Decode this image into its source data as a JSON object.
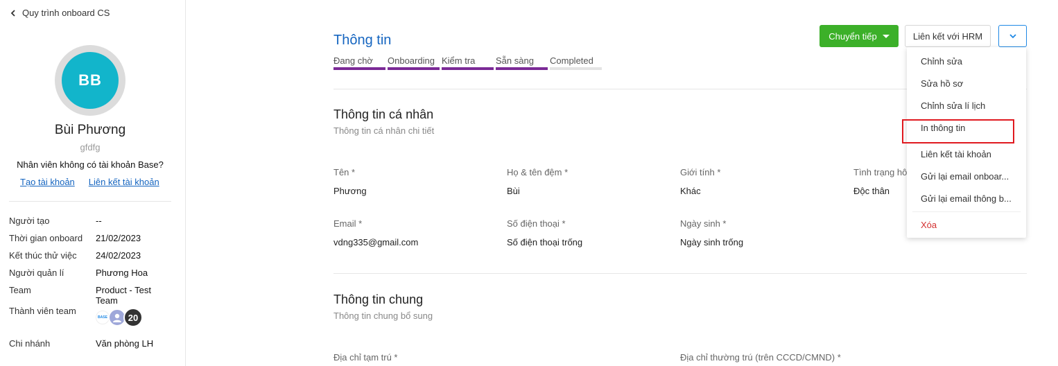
{
  "sidebar": {
    "back_label": "Quy trình onboard CS",
    "avatar_initials": "BB",
    "name": "Bùi Phương",
    "username": "gfdfg",
    "no_account_text": "Nhân viên không có tài khoản Base?",
    "create_account": "Tạo tài khoản",
    "link_account": "Liên kết tài khoản",
    "info": [
      {
        "label": "Người tạo",
        "value": "--"
      },
      {
        "label": "Thời gian onboard",
        "value": "21/02/2023"
      },
      {
        "label": "Kết thúc thử việc",
        "value": "24/02/2023"
      },
      {
        "label": "Người quản lí",
        "value": "Phương Hoa"
      },
      {
        "label": "Team",
        "value": "Product - Test Team"
      },
      {
        "label": "Thành viên team",
        "value": ""
      },
      {
        "label": "Chi nhánh",
        "value": "Văn phòng LH"
      }
    ],
    "member_base_label": "BASE",
    "member_count": "20"
  },
  "header": {
    "title": "Thông tin",
    "stages": [
      {
        "label": "Đang chờ",
        "done": true
      },
      {
        "label": "Onboarding",
        "done": true
      },
      {
        "label": "Kiểm tra",
        "done": true
      },
      {
        "label": "Sẵn sàng",
        "done": true
      },
      {
        "label": "Completed",
        "done": false
      }
    ],
    "forward_button": "Chuyển tiếp",
    "hrm_button": "Liên kết với HRM"
  },
  "personal": {
    "title": "Thông tin cá nhân",
    "subtitle": "Thông tin cá nhân chi tiết",
    "fields": [
      {
        "label": "Tên *",
        "value": "Phương"
      },
      {
        "label": "Họ & tên đệm *",
        "value": "Bùi"
      },
      {
        "label": "Giới tính *",
        "value": "Khác"
      },
      {
        "label": "Tình trạng hô",
        "value": "Độc thân"
      },
      {
        "label": "Email *",
        "value": "vdng335@gmail.com"
      },
      {
        "label": "Số điện thoại *",
        "value": "Số điện thoại trống"
      },
      {
        "label": "Ngày sinh *",
        "value": "Ngày sinh trống"
      }
    ]
  },
  "general": {
    "title": "Thông tin chung",
    "subtitle": "Thông tin chung bổ sung",
    "fields": [
      {
        "label": "Địa chỉ tạm trú *"
      },
      {
        "label": "Địa chỉ thường trú (trên CCCD/CMND) *"
      }
    ]
  },
  "menu": {
    "items": [
      "Chỉnh sửa",
      "Sửa hồ sơ",
      "Chỉnh sửa lí lịch",
      "In thông tin",
      "Liên kết tài khoản",
      "Gửi lại email onboar...",
      "Gửi lại email thông b..."
    ],
    "delete_label": "Xóa"
  },
  "colors": {
    "accent": "#1565c0",
    "stage_done": "#7b2a96",
    "forward_green": "#3cb029",
    "avatar": "#12b5cb",
    "highlight": "#e0191f"
  }
}
